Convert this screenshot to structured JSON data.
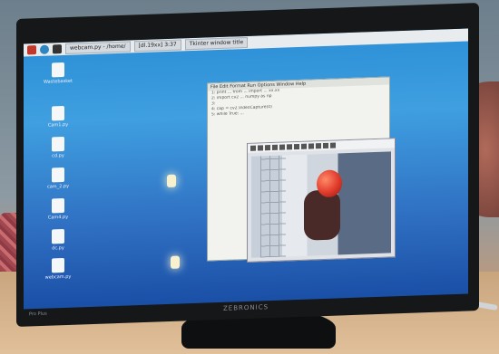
{
  "taskbar": {
    "buttons": [
      "webcam.py - /home/",
      "[dl.19xx] 3:37",
      "Tkinter window title"
    ]
  },
  "desktop_icons": [
    "Wastebasket",
    "Cam1.py",
    "cd.py",
    "cam_2.py",
    "Cam4.py",
    "dc.py",
    "webcam.py"
  ],
  "editor": {
    "menu": "File  Edit  Format  Run  Options  Window  Help",
    "lines": [
      "1: print ... from ... import ... xx.xx",
      "2: import cv2 ... numpy as np",
      "3:",
      "4: cap = cv2.VideoCapture(0)",
      "5: while True: ..."
    ]
  },
  "monitor": {
    "brand": "ZEBRONICS",
    "model": "Pro Plus"
  }
}
